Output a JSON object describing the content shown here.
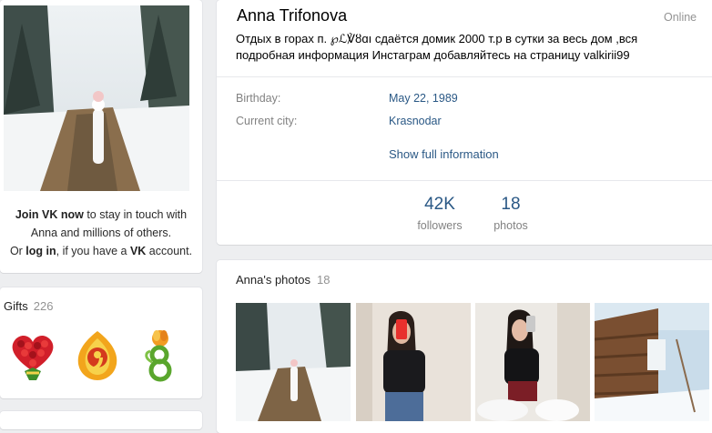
{
  "profile": {
    "name": "Anna Trifonova",
    "online": "Online",
    "status_line1": "Отдых в горах п. ℘ℒ℣ȣɑı сдаётся домик 2000 т.р в сутки за весь дом ,вся",
    "status_line2": "подробная информация Инстаграм добавляйтесь на страницу valkirii99",
    "birthday_label": "Birthday:",
    "birthday_value": "May 22, 1989",
    "city_label": "Current city:",
    "city_value": "Krasnodar",
    "show_full": "Show full information",
    "counters": [
      {
        "value": "42K",
        "label": "followers"
      },
      {
        "value": "18",
        "label": "photos"
      }
    ]
  },
  "join": {
    "join_link": "Join VK now",
    "text1": " to stay in touch with",
    "text2": "Anna and millions of others.",
    "or": "Or ",
    "login_link": "log in",
    "text3": ", if you have a ",
    "vk": "VK",
    "text4": " account."
  },
  "gifts": {
    "title": "Gifts",
    "count": "226",
    "items": [
      "rose-heart-bouquet-icon",
      "flame-nine-icon",
      "flower-eight-icon"
    ]
  },
  "photos": {
    "title": "Anna's photos",
    "count": "18"
  },
  "colors": {
    "background": "#edeef0",
    "link": "#2a5885",
    "muted": "#828282"
  }
}
